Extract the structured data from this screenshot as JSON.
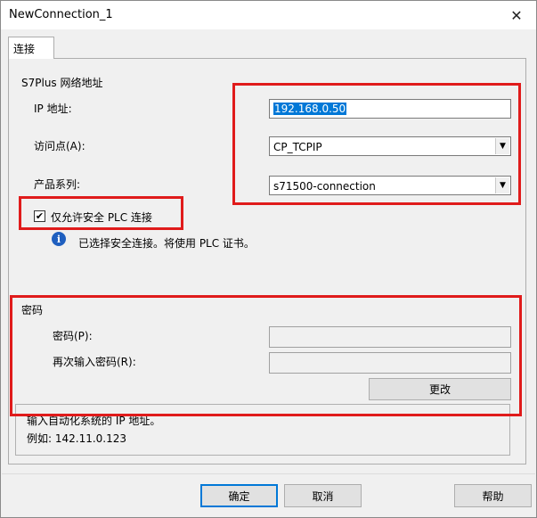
{
  "window": {
    "title": "NewConnection_1"
  },
  "tab": {
    "label": "连接"
  },
  "address": {
    "section_title": "S7Plus 网络地址",
    "ip_label": "IP 地址:",
    "ip_value": "192.168.0.50",
    "access_point_label": "访问点(A):",
    "access_point_value": "CP_TCPIP",
    "product_family_label": "产品系列:",
    "product_family_value": "s71500-connection"
  },
  "secure": {
    "checkbox_label": "仅允许安全 PLC 连接",
    "checked": true,
    "info_text": "已选择安全连接。将使用 PLC 证书。"
  },
  "password": {
    "section_title": "密码",
    "password_label": "密码(P):",
    "repeat_label": "再次输入密码(R):",
    "change_button": "更改"
  },
  "hint": {
    "line1": "输入自动化系统的 IP 地址。",
    "line2": "例如: 142.11.0.123"
  },
  "footer": {
    "ok": "确定",
    "cancel": "取消",
    "help": "帮助"
  },
  "colors": {
    "highlight_red": "#e01b1b",
    "selection_blue": "#0078d7",
    "info_blue": "#1f5fbf"
  },
  "icons": {
    "close": "close-icon",
    "info": "info-icon",
    "dropdown": "chevron-down-icon"
  }
}
